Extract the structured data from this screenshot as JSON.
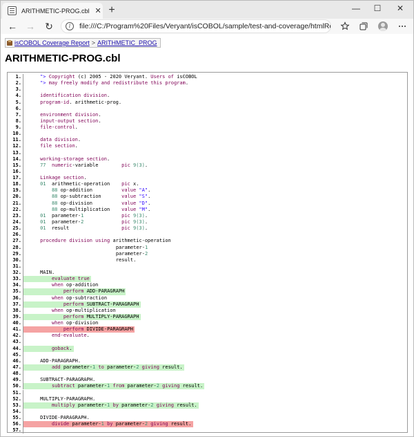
{
  "browser": {
    "tab_title": "ARITHMETIC-PROG.cbl",
    "tab_close": "✕",
    "new_tab": "+",
    "window_controls": [
      "—",
      "☐",
      "✕"
    ],
    "back": "←",
    "forward": "→",
    "reload": "↻",
    "info": "i",
    "url": "file:///C:/Program%20Files/Veryant/isCOBOL/sample/test-and-coverage/htmlRep...",
    "icons": [
      "favorites-star-icon",
      "collections-icon",
      "profile-avatar-icon",
      "more-menu-icon"
    ]
  },
  "breadcrumb": {
    "report_link": "isCOBOL Coverage Report",
    "separator": ">",
    "file_link": "ARITHMETIC_PROG"
  },
  "page_title": "ARITHMETIC-PROG.cbl",
  "colors": {
    "keyword": "#7f0055",
    "string": "#2a00ff",
    "number": "#3c8a6e",
    "plain": "#000000",
    "covered": "#c8f3c8",
    "uncovered": "#f5a3a3"
  },
  "lines": [
    {
      "n": "1.",
      "ind": 5,
      "hl": "",
      "parts": [
        [
          "s",
          "\"> "
        ],
        [
          "k",
          "Copyright"
        ],
        [
          "p",
          " (c) 2005 - 2020 Veryant. "
        ],
        [
          "k",
          "Users"
        ],
        [
          "p",
          " "
        ],
        [
          "k",
          "of"
        ],
        [
          "p",
          " isCOBOL"
        ]
      ]
    },
    {
      "n": "2.",
      "ind": 5,
      "hl": "",
      "parts": [
        [
          "s",
          "\"> "
        ],
        [
          "k",
          "may freely modify and redistribute this program"
        ],
        [
          "p",
          "."
        ]
      ]
    },
    {
      "n": "3.",
      "ind": 0,
      "hl": "",
      "parts": []
    },
    {
      "n": "4.",
      "ind": 5,
      "hl": "",
      "parts": [
        [
          "k",
          "identification division"
        ],
        [
          "p",
          "."
        ]
      ]
    },
    {
      "n": "5.",
      "ind": 5,
      "hl": "",
      "parts": [
        [
          "k",
          "program-id"
        ],
        [
          "p",
          ". arithmetic-prog."
        ]
      ]
    },
    {
      "n": "6.",
      "ind": 0,
      "hl": "",
      "parts": []
    },
    {
      "n": "7.",
      "ind": 5,
      "hl": "",
      "parts": [
        [
          "k",
          "environment division"
        ],
        [
          "p",
          "."
        ]
      ]
    },
    {
      "n": "8.",
      "ind": 5,
      "hl": "",
      "parts": [
        [
          "k",
          "input-output section"
        ],
        [
          "p",
          "."
        ]
      ]
    },
    {
      "n": "9.",
      "ind": 5,
      "hl": "",
      "parts": [
        [
          "k",
          "file-control"
        ],
        [
          "p",
          "."
        ]
      ]
    },
    {
      "n": "10.",
      "ind": 0,
      "hl": "",
      "parts": []
    },
    {
      "n": "11.",
      "ind": 5,
      "hl": "",
      "parts": [
        [
          "k",
          "data division"
        ],
        [
          "p",
          "."
        ]
      ]
    },
    {
      "n": "12.",
      "ind": 5,
      "hl": "",
      "parts": [
        [
          "k",
          "file section"
        ],
        [
          "p",
          "."
        ]
      ]
    },
    {
      "n": "13.",
      "ind": 0,
      "hl": "",
      "parts": []
    },
    {
      "n": "14.",
      "ind": 5,
      "hl": "",
      "parts": [
        [
          "k",
          "working-storage section"
        ],
        [
          "p",
          "."
        ]
      ]
    },
    {
      "n": "15.",
      "ind": 5,
      "hl": "",
      "parts": [
        [
          "g",
          "77"
        ],
        [
          "p",
          "  "
        ],
        [
          "k",
          "numeric"
        ],
        [
          "p",
          "-variable        "
        ],
        [
          "k",
          "pic"
        ],
        [
          "p",
          " "
        ],
        [
          "g",
          "9(3)"
        ],
        [
          "p",
          "."
        ]
      ]
    },
    {
      "n": "16.",
      "ind": 0,
      "hl": "",
      "parts": []
    },
    {
      "n": "17.",
      "ind": 5,
      "hl": "",
      "parts": [
        [
          "k",
          "Linkage section"
        ],
        [
          "p",
          "."
        ]
      ]
    },
    {
      "n": "18.",
      "ind": 5,
      "hl": "",
      "parts": [
        [
          "g",
          "01"
        ],
        [
          "p",
          "  arithmetic-operation    "
        ],
        [
          "k",
          "pic"
        ],
        [
          "p",
          " x."
        ]
      ]
    },
    {
      "n": "19.",
      "ind": 9,
      "hl": "",
      "parts": [
        [
          "g",
          "88"
        ],
        [
          "p",
          " op-addition          "
        ],
        [
          "k",
          "value"
        ],
        [
          "p",
          " "
        ],
        [
          "s",
          "\"A\""
        ],
        [
          "p",
          "."
        ]
      ]
    },
    {
      "n": "20.",
      "ind": 9,
      "hl": "",
      "parts": [
        [
          "g",
          "88"
        ],
        [
          "p",
          " op-subtraction       "
        ],
        [
          "k",
          "value"
        ],
        [
          "p",
          " "
        ],
        [
          "s",
          "\"S\""
        ],
        [
          "p",
          "."
        ]
      ]
    },
    {
      "n": "21.",
      "ind": 9,
      "hl": "",
      "parts": [
        [
          "g",
          "88"
        ],
        [
          "p",
          " op-division          "
        ],
        [
          "k",
          "value"
        ],
        [
          "p",
          " "
        ],
        [
          "s",
          "\"D\""
        ],
        [
          "p",
          "."
        ]
      ]
    },
    {
      "n": "22.",
      "ind": 9,
      "hl": "",
      "parts": [
        [
          "g",
          "88"
        ],
        [
          "p",
          " op-multiplication    "
        ],
        [
          "k",
          "value"
        ],
        [
          "p",
          " "
        ],
        [
          "s",
          "\"M\""
        ],
        [
          "p",
          "."
        ]
      ]
    },
    {
      "n": "23.",
      "ind": 5,
      "hl": "",
      "parts": [
        [
          "g",
          "01"
        ],
        [
          "p",
          "  parameter-"
        ],
        [
          "g",
          "1"
        ],
        [
          "p",
          "             "
        ],
        [
          "k",
          "pic"
        ],
        [
          "p",
          " "
        ],
        [
          "g",
          "9(3)"
        ],
        [
          "p",
          "."
        ]
      ]
    },
    {
      "n": "24.",
      "ind": 5,
      "hl": "",
      "parts": [
        [
          "g",
          "01"
        ],
        [
          "p",
          "  parameter-"
        ],
        [
          "g",
          "2"
        ],
        [
          "p",
          "             "
        ],
        [
          "k",
          "pic"
        ],
        [
          "p",
          " "
        ],
        [
          "g",
          "9(3)"
        ],
        [
          "p",
          "."
        ]
      ]
    },
    {
      "n": "25.",
      "ind": 5,
      "hl": "",
      "parts": [
        [
          "g",
          "01"
        ],
        [
          "p",
          "  result                  "
        ],
        [
          "k",
          "pic"
        ],
        [
          "p",
          " "
        ],
        [
          "g",
          "9(3)"
        ],
        [
          "p",
          "."
        ]
      ]
    },
    {
      "n": "26.",
      "ind": 0,
      "hl": "",
      "parts": []
    },
    {
      "n": "27.",
      "ind": 5,
      "hl": "",
      "parts": [
        [
          "k",
          "procedure division using"
        ],
        [
          "p",
          " arithmetic-operation"
        ]
      ]
    },
    {
      "n": "28.",
      "ind": 31,
      "hl": "",
      "parts": [
        [
          "p",
          "parameter-"
        ],
        [
          "g",
          "1"
        ]
      ]
    },
    {
      "n": "29.",
      "ind": 31,
      "hl": "",
      "parts": [
        [
          "p",
          "parameter-"
        ],
        [
          "g",
          "2"
        ]
      ]
    },
    {
      "n": "30.",
      "ind": 31,
      "hl": "",
      "parts": [
        [
          "p",
          "result."
        ]
      ]
    },
    {
      "n": "31.",
      "ind": 0,
      "hl": "",
      "parts": []
    },
    {
      "n": "32.",
      "ind": 5,
      "hl": "",
      "parts": [
        [
          "p",
          "MAIN."
        ]
      ]
    },
    {
      "n": "33.",
      "ind": 9,
      "hl": "covered",
      "parts": [
        [
          "k",
          "evaluate true"
        ]
      ]
    },
    {
      "n": "34.",
      "ind": 9,
      "hl": "",
      "parts": [
        [
          "k",
          "when"
        ],
        [
          "p",
          " op-addition"
        ]
      ]
    },
    {
      "n": "35.",
      "ind": 13,
      "hl": "covered",
      "parts": [
        [
          "k",
          "perform"
        ],
        [
          "p",
          " ADD-PARAGRAPH"
        ]
      ]
    },
    {
      "n": "36.",
      "ind": 9,
      "hl": "",
      "parts": [
        [
          "k",
          "when"
        ],
        [
          "p",
          " op-subtraction"
        ]
      ]
    },
    {
      "n": "37.",
      "ind": 13,
      "hl": "covered",
      "parts": [
        [
          "k",
          "perform"
        ],
        [
          "p",
          " SUBTRACT-PARAGRAPH"
        ]
      ]
    },
    {
      "n": "38.",
      "ind": 9,
      "hl": "",
      "parts": [
        [
          "k",
          "when"
        ],
        [
          "p",
          " op-multiplication"
        ]
      ]
    },
    {
      "n": "39.",
      "ind": 13,
      "hl": "covered",
      "parts": [
        [
          "k",
          "perform"
        ],
        [
          "p",
          " MULTIPLY-PARAGRAPH"
        ]
      ]
    },
    {
      "n": "40.",
      "ind": 9,
      "hl": "",
      "parts": [
        [
          "k",
          "when"
        ],
        [
          "p",
          " op-division"
        ]
      ]
    },
    {
      "n": "41.",
      "ind": 13,
      "hl": "uncovered",
      "parts": [
        [
          "k",
          "perform"
        ],
        [
          "p",
          " DIVIDE-PARAGRAPH"
        ]
      ]
    },
    {
      "n": "42.",
      "ind": 9,
      "hl": "",
      "parts": [
        [
          "k",
          "end-evaluate"
        ],
        [
          "p",
          "."
        ]
      ]
    },
    {
      "n": "43.",
      "ind": 0,
      "hl": "",
      "parts": []
    },
    {
      "n": "44.",
      "ind": 9,
      "hl": "covered",
      "parts": [
        [
          "k",
          "goback"
        ],
        [
          "p",
          "."
        ]
      ]
    },
    {
      "n": "45.",
      "ind": 0,
      "hl": "",
      "parts": []
    },
    {
      "n": "46.",
      "ind": 5,
      "hl": "",
      "parts": [
        [
          "p",
          "ADD-PARAGRAPH."
        ]
      ]
    },
    {
      "n": "47.",
      "ind": 9,
      "hl": "covered",
      "parts": [
        [
          "k",
          "add"
        ],
        [
          "p",
          " parameter-"
        ],
        [
          "g",
          "1"
        ],
        [
          "p",
          " "
        ],
        [
          "k",
          "to"
        ],
        [
          "p",
          " parameter-"
        ],
        [
          "g",
          "2"
        ],
        [
          "p",
          " "
        ],
        [
          "k",
          "giving"
        ],
        [
          "p",
          " result."
        ]
      ]
    },
    {
      "n": "48.",
      "ind": 0,
      "hl": "",
      "parts": []
    },
    {
      "n": "49.",
      "ind": 5,
      "hl": "",
      "parts": [
        [
          "p",
          "SUBTRACT-PARAGRAPH."
        ]
      ]
    },
    {
      "n": "50.",
      "ind": 9,
      "hl": "covered",
      "parts": [
        [
          "k",
          "subtract"
        ],
        [
          "p",
          " parameter-"
        ],
        [
          "g",
          "1"
        ],
        [
          "p",
          " "
        ],
        [
          "k",
          "from"
        ],
        [
          "p",
          " parameter-"
        ],
        [
          "g",
          "2"
        ],
        [
          "p",
          " "
        ],
        [
          "k",
          "giving"
        ],
        [
          "p",
          " result."
        ]
      ]
    },
    {
      "n": "51.",
      "ind": 0,
      "hl": "",
      "parts": []
    },
    {
      "n": "52.",
      "ind": 5,
      "hl": "",
      "parts": [
        [
          "p",
          "MULTIPLY-PARAGRAPH."
        ]
      ]
    },
    {
      "n": "53.",
      "ind": 9,
      "hl": "covered",
      "parts": [
        [
          "k",
          "multiply"
        ],
        [
          "p",
          " parameter-"
        ],
        [
          "g",
          "1"
        ],
        [
          "p",
          " "
        ],
        [
          "k",
          "by"
        ],
        [
          "p",
          " parameter-"
        ],
        [
          "g",
          "2"
        ],
        [
          "p",
          " "
        ],
        [
          "k",
          "giving"
        ],
        [
          "p",
          " result."
        ]
      ]
    },
    {
      "n": "54.",
      "ind": 0,
      "hl": "",
      "parts": []
    },
    {
      "n": "55.",
      "ind": 5,
      "hl": "",
      "parts": [
        [
          "p",
          "DIVIDE-PARAGRAPH."
        ]
      ]
    },
    {
      "n": "56.",
      "ind": 9,
      "hl": "uncovered",
      "parts": [
        [
          "k",
          "divide"
        ],
        [
          "p",
          " parameter-"
        ],
        [
          "g",
          "1"
        ],
        [
          "p",
          " "
        ],
        [
          "k",
          "by"
        ],
        [
          "p",
          " parameter-"
        ],
        [
          "g",
          "2"
        ],
        [
          "p",
          " "
        ],
        [
          "k",
          "giving"
        ],
        [
          "p",
          " result."
        ]
      ]
    },
    {
      "n": "57.",
      "ind": 0,
      "hl": "",
      "parts": []
    }
  ]
}
